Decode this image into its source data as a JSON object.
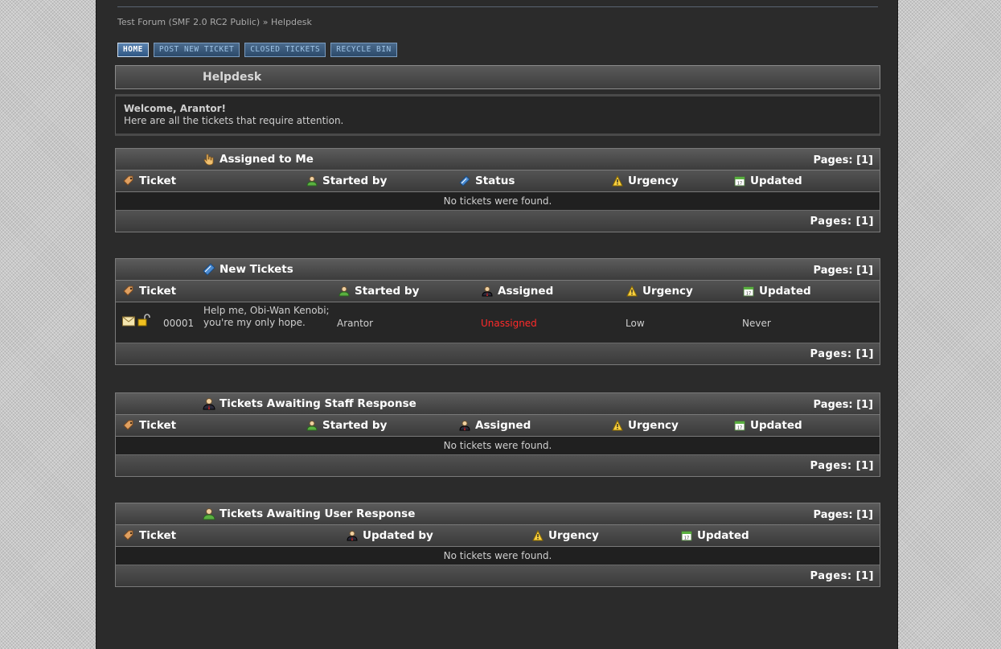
{
  "breadcrumb": {
    "forum": "Test Forum (SMF 2.0 RC2 Public)",
    "sep": "»",
    "page": "Helpdesk"
  },
  "tabs": [
    "HOME",
    "POST NEW TICKET",
    "CLOSED TICKETS",
    "RECYCLE BIN"
  ],
  "helpdesk_title": "Helpdesk",
  "welcome": {
    "line1": "Welcome, Arantor!",
    "line2": "Here are all the tickets that require attention."
  },
  "pages_label": "Pages: [1]",
  "no_tickets": "No tickets were found.",
  "sections": {
    "assigned": {
      "title": "Assigned to Me",
      "cols": [
        "Ticket",
        "Started by",
        "Status",
        "Urgency",
        "Updated"
      ]
    },
    "new": {
      "title": "New Tickets",
      "cols": [
        "Ticket",
        "Started by",
        "Assigned",
        "Urgency",
        "Updated"
      ],
      "rows": [
        {
          "id": "00001",
          "subject": "Help me, Obi-Wan Kenobi; you're my only hope.",
          "started_by": "Arantor",
          "assigned": "Unassigned",
          "urgency": "Low",
          "updated": "Never"
        }
      ]
    },
    "staff": {
      "title": "Tickets Awaiting Staff Response",
      "cols": [
        "Ticket",
        "Started by",
        "Assigned",
        "Urgency",
        "Updated"
      ]
    },
    "user": {
      "title": "Tickets Awaiting User Response",
      "cols": [
        "Ticket",
        "Updated by",
        "Urgency",
        "Updated"
      ]
    }
  },
  "colors": {
    "unassigned": "#ff2a2a",
    "tab_text": "#9fc4e6"
  }
}
